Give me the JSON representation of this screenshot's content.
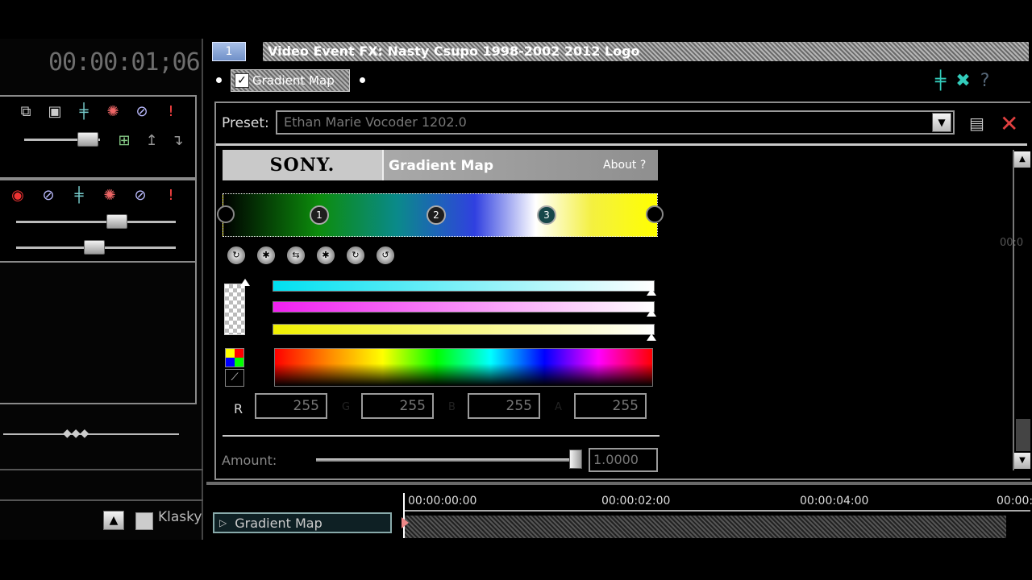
{
  "left_panel": {
    "timecode": "00:00:01;06",
    "media_label": "Klasky"
  },
  "header": {
    "tab_number": "1",
    "title": "Video Event FX: Nasty Csupo 1998-2002 2012 Logo",
    "chain_plugin": "Gradient Map"
  },
  "preset": {
    "label": "Preset:",
    "value": "Ethan Marie Vocoder 1202.0"
  },
  "plugin": {
    "brand": "SONY.",
    "name": "Gradient Map",
    "about": "About  ?",
    "stops": [
      "1",
      "2",
      "3"
    ],
    "channels": [
      {
        "label": "R",
        "value": "255"
      },
      {
        "label": "G",
        "value": "255"
      },
      {
        "label": "B",
        "value": "255"
      },
      {
        "label": "A",
        "value": "255"
      }
    ],
    "amount_label": "Amount:",
    "amount_value": "1.0000",
    "amount_level": 1.0
  },
  "timeline": {
    "track_name": "Gradient Map",
    "times": [
      "00:00:00:00",
      "00:00:02:00",
      "00:00:04:00",
      "00:00:"
    ],
    "side_time": "00:0"
  },
  "colors": {
    "accent": "#7090c8",
    "close": "#e04040"
  }
}
